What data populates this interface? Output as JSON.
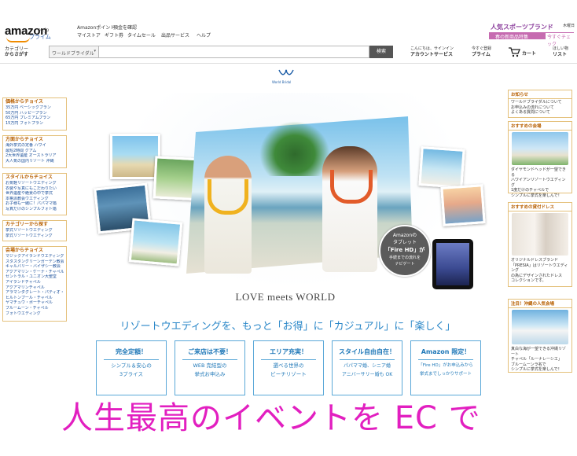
{
  "header": {
    "logo": "amazon",
    "logo_sub": "co.jp",
    "logo_tagline": "プライム",
    "top_links_row1": [
      "Amazonポイント",
      "預金を確認"
    ],
    "top_links_row2": [
      "マイストア",
      "ギフト券",
      "タイムセール",
      "出品サービス",
      "ヘルプ"
    ],
    "promo_title": "人気スポーツブランド",
    "promo_band_left": "春の新商品特集",
    "promo_band_right": "今すぐチェック",
    "promo_corner": "木曜日"
  },
  "search": {
    "category_label_1": "カテゴリー",
    "category_label_2": "からさがす",
    "select_value": "ワールドブライダル",
    "button_label": "検索"
  },
  "nav": {
    "account_1": "こんにちは、サインイン",
    "account_2": "アカウントサービス",
    "prime_1": "今すぐ登録",
    "prime_2": "プライム",
    "cart_label": "カート",
    "wishlist_1": "ほしい物",
    "wishlist_2": "リスト"
  },
  "left_sidebar": [
    {
      "title": "価格からチョイス",
      "items": [
        "35万円 ベーシックプラン",
        "50万円 ハッピープラン",
        "65万円 プレミアムプラン",
        "15万円 フォトプラン"
      ]
    },
    {
      "title": "方面からチョイス",
      "items": [
        "海外挙式の定番 ハワイ",
        "最短2時間 グアム",
        "2大世界遺産 オーストラリア",
        "大人気の国内リゾート 沖縄"
      ]
    },
    {
      "title": "スタイルからチョイス",
      "items": [
        "お気軽リゾートウエディング",
        "衣装や写真にもこだわりたい",
        "世界遺産や絶景の中で挙式",
        "本格派教会ウエディング",
        "お子様も一緒に！パパママ婚",
        "写真だけのシンプルフォト婚"
      ]
    },
    {
      "title": "カテゴリーから探す",
      "items": [
        "挙式リゾートウエディング",
        "挙式リゾートウエディング"
      ]
    },
    {
      "title": "会場からチョイス",
      "items": [
        "マジックアイランドウエディング",
        "スタスタングリーンガーデン教会",
        "キャルバリー・バイザシー教会",
        "アクアマリン・ケーナ・チャペル",
        "セントラル・ユニオン大聖堂",
        "アイランドチャペル",
        "アクアマリンチャペル",
        "アラマンダグレート・パティオ・チャペル",
        "ヒルトンプール・チャペル",
        "ヤマチュウ・ボーチャペル",
        "ブルームーン・チャペル",
        "フォトウエディング"
      ]
    }
  ],
  "right_sidebar": [
    {
      "title": "お知らせ",
      "text": [
        "ワールドブライダルについて",
        "お申込みの流れについて",
        "よくある質問について"
      ]
    },
    {
      "title": "おすすめの会場",
      "text": [
        "ダイヤモンドヘッドが一望できる",
        "ハワイアンリゾートウエディング",
        "1度だけのチャペルで",
        "シンプルに挙式を楽しんで！"
      ]
    },
    {
      "title": "おすすめの貸付ドレス",
      "text": [
        "オリジナルドレスブランド",
        "「PRESIA」はリゾートウエディング",
        "の為にデザインされたドレス",
        "コレクションです。"
      ]
    },
    {
      "title": "注目！沖縄の人気会場",
      "text": [
        "真白な海が一望できる沖縄リゾート",
        "チャペル「ルーナレーシエ」",
        "ブルームーンラ名で",
        "シンプルに挙式を楽しんで！"
      ]
    }
  ],
  "main": {
    "brand_logo": "WB",
    "brand_sub": "World Bridal",
    "promo_badge": [
      "Amazonの",
      "タブレット",
      "「Fire HD」が",
      "手続までの流れを",
      "ナビゲート"
    ],
    "tagline": "LOVE meets WORLD",
    "headline": "リゾートウエディングを、もっと「お得」に「カジュアル」に「楽しく」",
    "features": [
      {
        "title": "完全定額！",
        "line1": "シンプル＆安心の",
        "line2": "3プライス"
      },
      {
        "title": "ご来店は不要！",
        "line1": "WEB 完結型の",
        "line2": "挙式お申込み"
      },
      {
        "title": "エリア充実！",
        "line1": "選べる世界の",
        "line2": "ビーチリゾート"
      },
      {
        "title": "スタイル自由自在！",
        "line1": "パパママ婚、シニア婚",
        "line2": "アニバーサリー婚も OK"
      },
      {
        "title": "Amazon 限定！",
        "line1": "「Fire HD」がお申込みから",
        "line2": "挙式までしっかりサポート"
      }
    ]
  },
  "caption": "人生最高のイベントを EC で",
  "colors": {
    "accent_blue": "#2a87c8",
    "caption_pink": "#e21fc0",
    "sidebar_border": "#e4c07a",
    "sidebar_title": "#b75f00"
  }
}
